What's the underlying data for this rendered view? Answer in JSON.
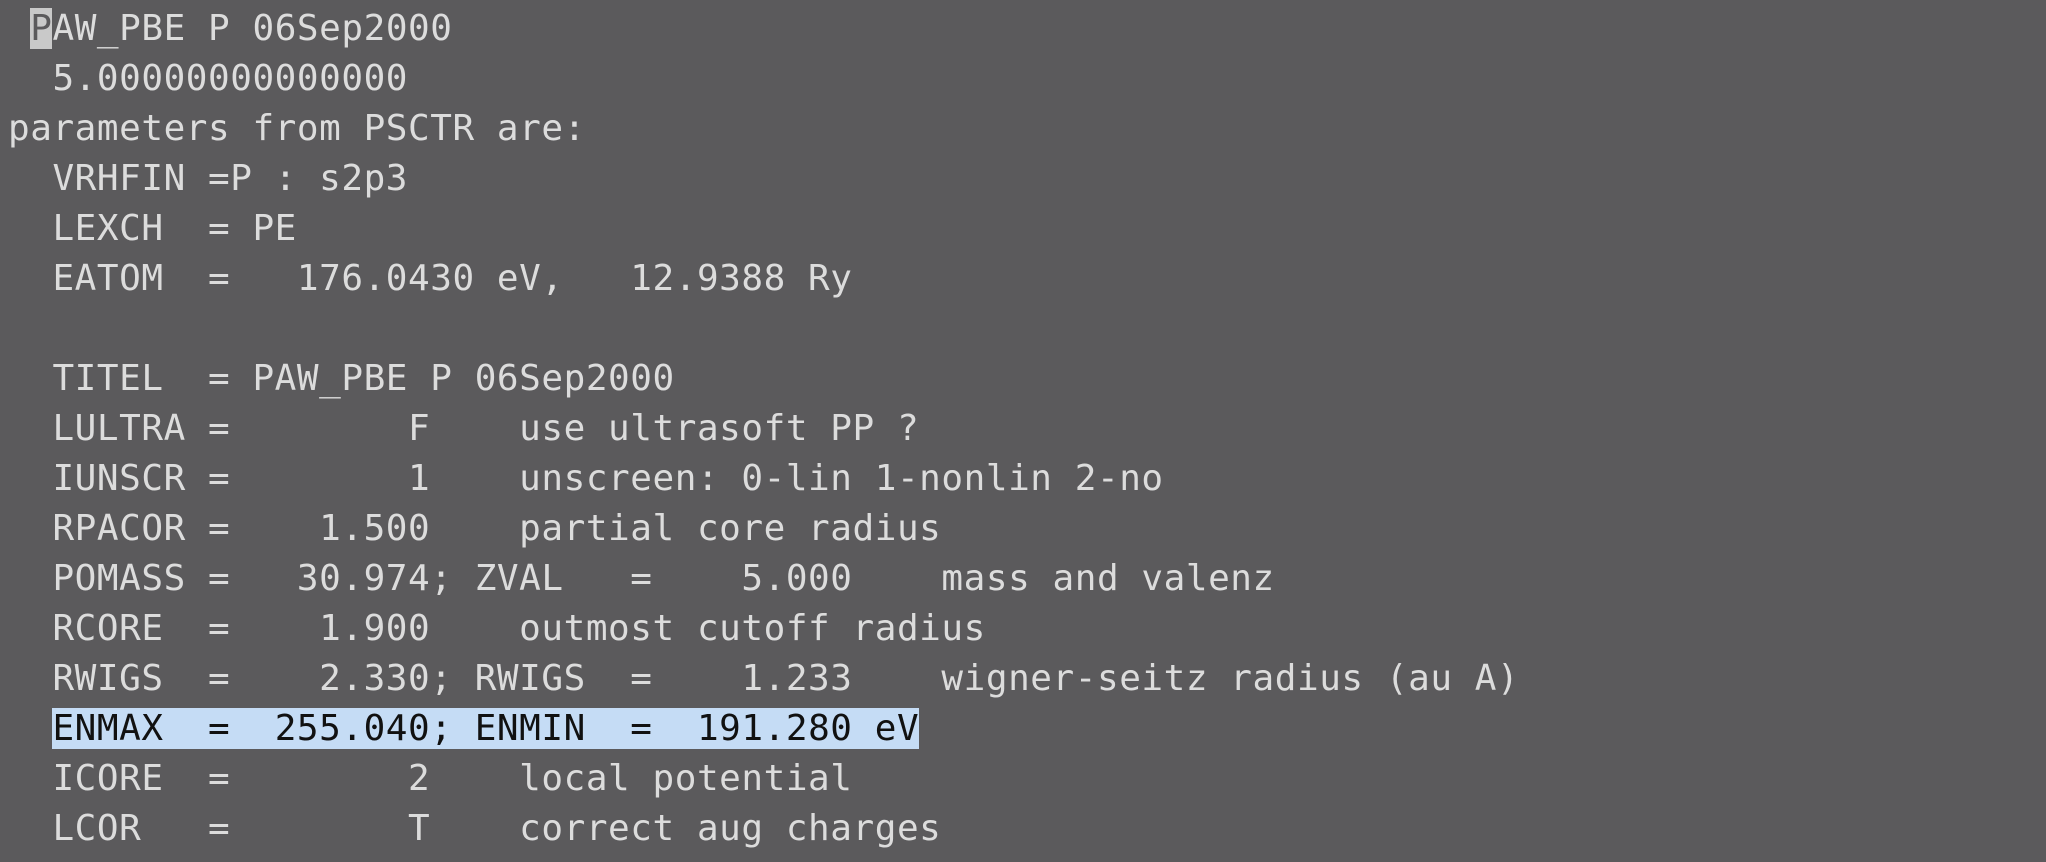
{
  "terminal": {
    "cursor_char": "P",
    "lines": [
      {
        "text": "AW_PBE P 06Sep2000",
        "prefix": " "
      },
      {
        "text": "  5.00000000000000"
      },
      {
        "text": "parameters from PSCTR are:"
      },
      {
        "text": "  VRHFIN =P : s2p3"
      },
      {
        "text": "  LEXCH  = PE"
      },
      {
        "text": "  EATOM  =   176.0430 eV,   12.9388 Ry"
      },
      {
        "text": ""
      },
      {
        "text": "  TITEL  = PAW_PBE P 06Sep2000"
      },
      {
        "text": "  LULTRA =        F    use ultrasoft PP ?"
      },
      {
        "text": "  IUNSCR =        1    unscreen: 0-lin 1-nonlin 2-no"
      },
      {
        "text": "  RPACOR =    1.500    partial core radius"
      },
      {
        "text": "  POMASS =   30.974; ZVAL   =    5.000    mass and valenz"
      },
      {
        "text": "  RCORE  =    1.900    outmost cutoff radius"
      },
      {
        "text": "  RWIGS  =    2.330; RWIGS  =    1.233    wigner-seitz radius (au A)"
      },
      {
        "text": "ENMAX  =  255.040; ENMIN  =  191.280 eV",
        "prefix": "  ",
        "selected": true
      },
      {
        "text": "  ICORE  =        2    local potential"
      },
      {
        "text": "  LCOR   =        T    correct aug charges"
      }
    ]
  }
}
